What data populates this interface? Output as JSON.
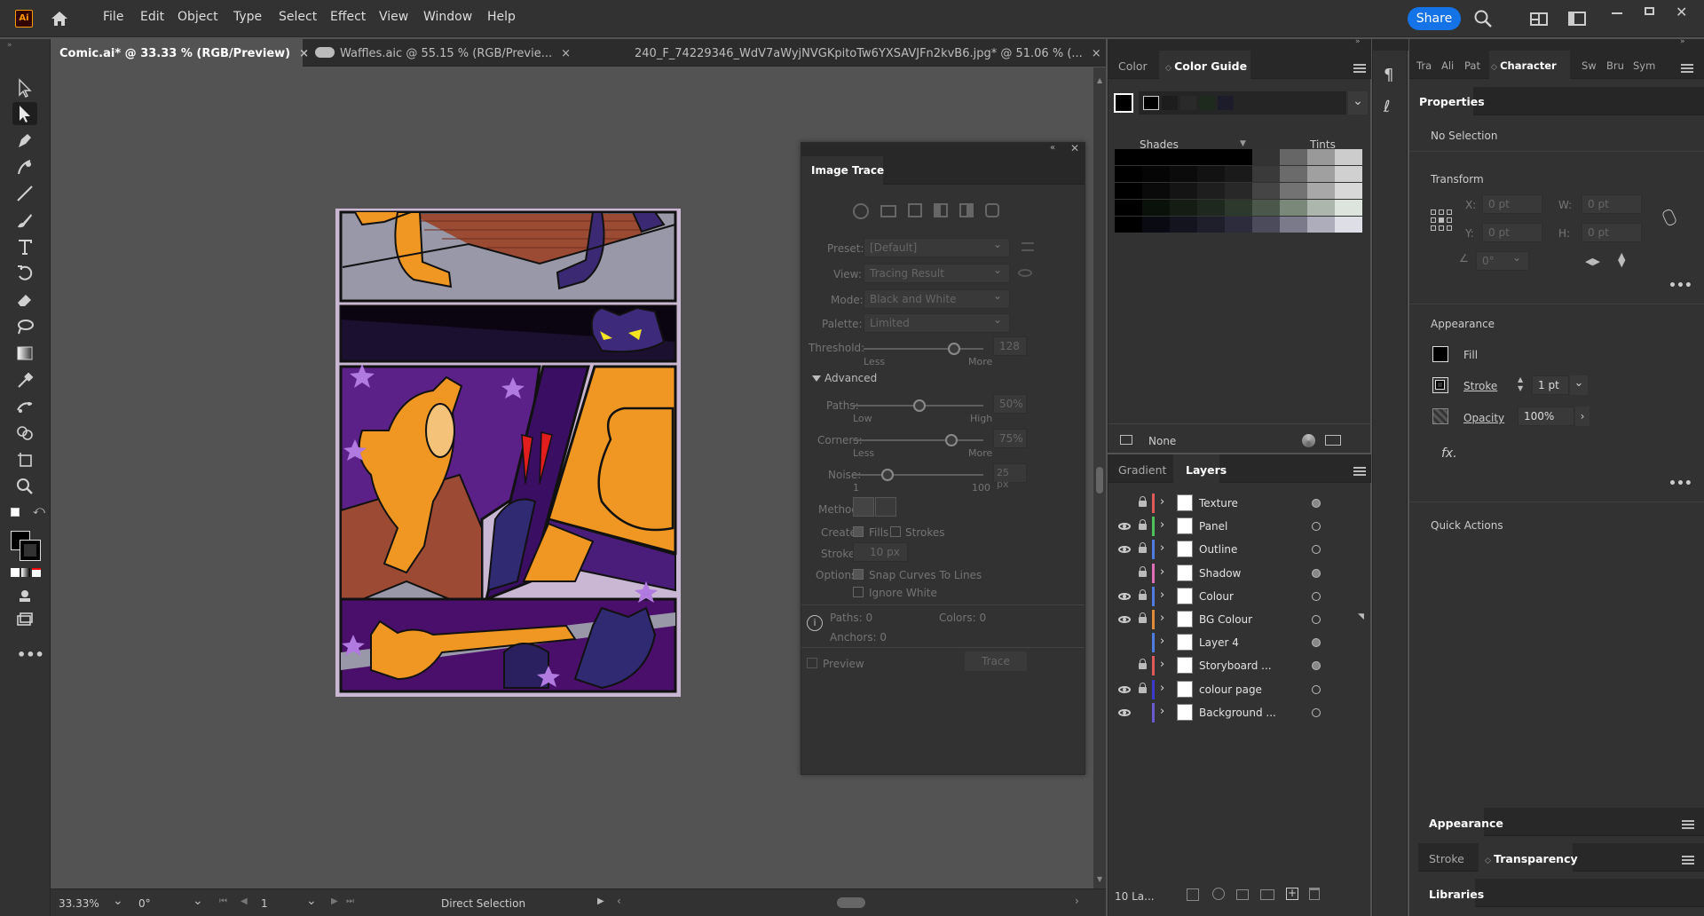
{
  "app": {
    "logo": "Ai",
    "share_label": "Share"
  },
  "menu": [
    "File",
    "Edit",
    "Object",
    "Type",
    "Select",
    "Effect",
    "View",
    "Window",
    "Help"
  ],
  "doc_tabs": [
    {
      "label": "Comic.ai* @ 33.33 % (RGB/Preview)",
      "close": "×",
      "active": true
    },
    {
      "label": "Waffles.aic @ 55.15 % (RGB/Previe...",
      "close": "×",
      "cloud": true
    },
    {
      "label": "240_F_74229346_WdV7aWyjNVGKpitoTw6YXSAVJFn2kvB6.jpg* @ 51.06 % (...",
      "close": "×"
    }
  ],
  "status": {
    "zoom": "33.33%",
    "rotation": "0°",
    "artboard": "1",
    "tool": "Direct Selection"
  },
  "image_trace": {
    "title": "Image Trace",
    "preset_label": "Preset:",
    "preset": "[Default]",
    "view_label": "View:",
    "view": "Tracing Result",
    "mode_label": "Mode:",
    "mode": "Black and White",
    "palette_label": "Palette:",
    "palette": "Limited",
    "threshold_label": "Threshold:",
    "threshold": "128",
    "less": "Less",
    "more": "More",
    "advanced": "Advanced",
    "paths_label": "Paths:",
    "paths": "50%",
    "low": "Low",
    "high": "High",
    "corners_label": "Corners:",
    "corners": "75%",
    "noise_label": "Noise:",
    "noise": "25 px",
    "noise_min": "1",
    "noise_max": "100",
    "method_label": "Method:",
    "create_label": "Create:",
    "fills": "Fills",
    "strokes": "Strokes",
    "stroke_label": "Stroke:",
    "stroke": "10 px",
    "options_label": "Options:",
    "snap": "Snap Curves To Lines",
    "ignore": "Ignore White",
    "info_paths": "Paths:  0",
    "info_colors": "Colors:  0",
    "info_anchors": "Anchors:  0",
    "preview": "Preview",
    "trace": "Trace"
  },
  "color_panel": {
    "tab1": "Color",
    "tab2": "Color Guide",
    "shades": "Shades",
    "tints": "Tints",
    "none": "None"
  },
  "layers_panel": {
    "tab1": "Gradient",
    "tab2": "Layers",
    "count": "10 La...",
    "layers": [
      {
        "name": "Texture",
        "eye": false,
        "lock": true,
        "color": "#e05a5a"
      },
      {
        "name": "Panel",
        "eye": true,
        "lock": true,
        "color": "#4fc15a"
      },
      {
        "name": "Outline",
        "eye": true,
        "lock": true,
        "color": "#4f7ce0"
      },
      {
        "name": "Shadow",
        "eye": false,
        "lock": true,
        "color": "#e06fb8"
      },
      {
        "name": "Colour",
        "eye": true,
        "lock": true,
        "color": "#4f7ce0"
      },
      {
        "name": "BG Colour",
        "eye": true,
        "lock": true,
        "color": "#e08a3a"
      },
      {
        "name": "Layer 4",
        "eye": false,
        "lock": false,
        "color": "#4f7ce0"
      },
      {
        "name": "Storyboard ...",
        "eye": false,
        "lock": true,
        "color": "#e05a5a"
      },
      {
        "name": "colour page",
        "eye": true,
        "lock": true,
        "color": "#3a3ad0"
      },
      {
        "name": "Background ...",
        "eye": true,
        "lock": false,
        "color": "#6a5ad0"
      }
    ]
  },
  "right_tabs": [
    "Tra",
    "Ali",
    "Pat",
    "Character",
    "Sw",
    "Bru",
    "Sym"
  ],
  "properties": {
    "tab": "Properties",
    "no_selection": "No Selection",
    "transform": "Transform",
    "x_label": "X:",
    "x": "0 pt",
    "y_label": "Y:",
    "y": "0 pt",
    "w_label": "W:",
    "w": "0 pt",
    "h_label": "H:",
    "h": "0 pt",
    "angle": "0°",
    "appearance": "Appearance",
    "fill": "Fill",
    "stroke": "Stroke",
    "stroke_val": "1 pt",
    "opacity": "Opacity",
    "opacity_val": "100%",
    "fx": "fx.",
    "quick_actions": "Quick Actions"
  },
  "bottom_panels": {
    "appearance": "Appearance",
    "stroke": "Stroke",
    "transparency": "Transparency",
    "libraries": "Libraries"
  }
}
